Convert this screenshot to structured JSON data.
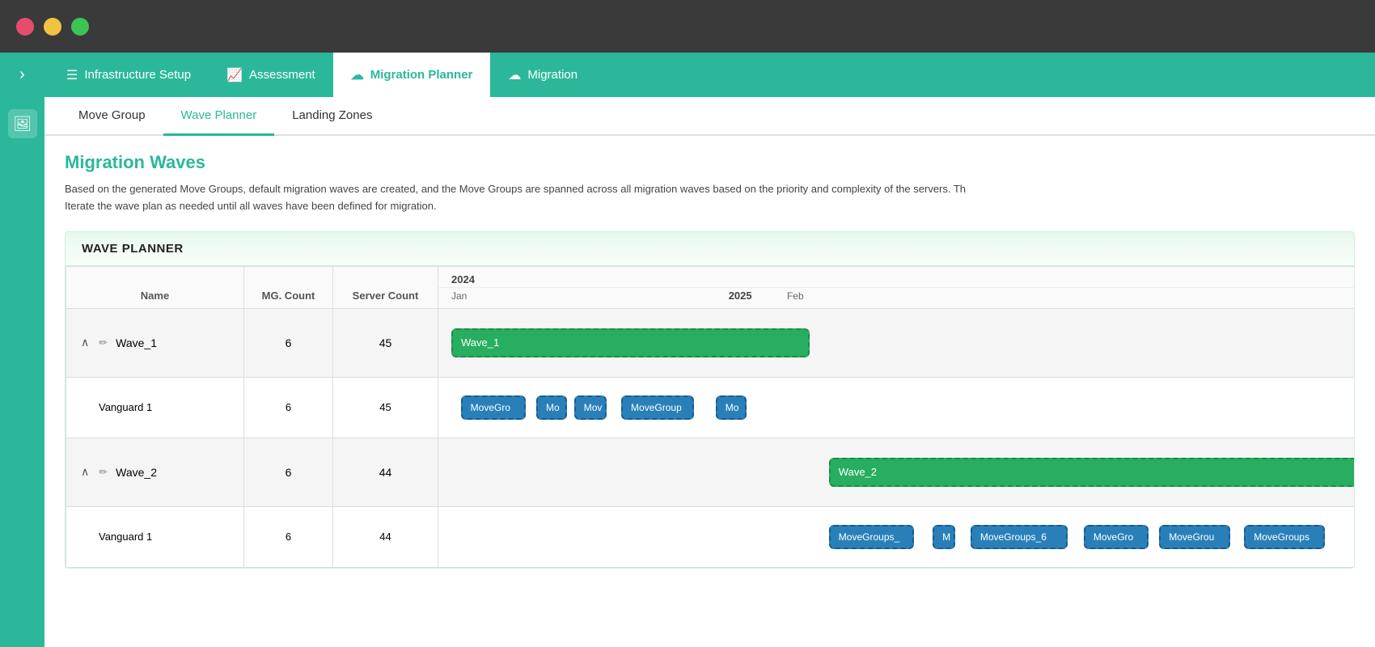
{
  "titleBar": {
    "trafficLights": [
      "red",
      "yellow",
      "green"
    ]
  },
  "topNav": {
    "toggleIcon": "☰",
    "items": [
      {
        "id": "infrastructure",
        "label": "Infrastructure Setup",
        "icon": "≡",
        "active": false
      },
      {
        "id": "assessment",
        "label": "Assessment",
        "icon": "📊",
        "active": false
      },
      {
        "id": "migration-planner",
        "label": "Migration Planner",
        "icon": "☁",
        "active": true
      },
      {
        "id": "migration",
        "label": "Migration",
        "icon": "☁",
        "active": false
      }
    ]
  },
  "sidebar": {
    "icons": [
      "🖼"
    ]
  },
  "tabs": [
    {
      "id": "move-group",
      "label": "Move Group",
      "active": false
    },
    {
      "id": "wave-planner",
      "label": "Wave Planner",
      "active": true
    },
    {
      "id": "landing-zones",
      "label": "Landing Zones",
      "active": false
    }
  ],
  "content": {
    "title": "Migration Waves",
    "description1": "Based on the generated Move Groups, default migration waves are created, and the Move Groups are spanned across all migration waves based on the priority and complexity of the servers. Th",
    "description2": "Iterate the wave plan as needed until all waves have been defined for migration.",
    "wavePlanner": {
      "header": "WAVE PLANNER",
      "tableHeaders": {
        "name": "Name",
        "mgCount": "MG. Count",
        "serverCount": "Server Count"
      },
      "timelineYears": [
        {
          "label": "2024",
          "colSpan": 1
        },
        {
          "label": "2025",
          "colSpan": 1
        }
      ],
      "timelineMonths": [
        "Jan",
        "Feb"
      ],
      "rows": [
        {
          "type": "wave",
          "name": "Wave_1",
          "mgCount": "6",
          "serverCount": "45",
          "gantt": [
            {
              "type": "green",
              "label": "Wave_1",
              "leftPct": 0,
              "widthPct": 38
            }
          ],
          "subrows": [
            {
              "name": "Vanguard 1",
              "mgCount": "6",
              "serverCount": "45",
              "gantt": [
                {
                  "type": "blue",
                  "label": "MoveGro",
                  "leftPct": 1,
                  "widthPx": 80
                },
                {
                  "type": "blue",
                  "label": "Mo",
                  "leftPct": 9,
                  "widthPx": 38
                },
                {
                  "type": "blue",
                  "label": "Mov",
                  "leftPct": 13,
                  "widthPx": 40
                },
                {
                  "type": "blue",
                  "label": "MoveGroup",
                  "leftPct": 18,
                  "widthPx": 90
                },
                {
                  "type": "blue",
                  "label": "Mo",
                  "leftPct": 28,
                  "widthPx": 38
                }
              ]
            }
          ]
        },
        {
          "type": "wave",
          "name": "Wave_2",
          "mgCount": "6",
          "serverCount": "44",
          "gantt": [
            {
              "type": "green",
              "label": "Wave_2",
              "leftPct": 40,
              "widthPct": 58
            }
          ],
          "subrows": [
            {
              "name": "Vanguard 1",
              "mgCount": "6",
              "serverCount": "44",
              "gantt": [
                {
                  "type": "blue",
                  "label": "MoveGroups_",
                  "leftPct": 40,
                  "widthPx": 105
                },
                {
                  "type": "blue",
                  "label": "M",
                  "leftPct": 51,
                  "widthPx": 28
                },
                {
                  "type": "blue",
                  "label": "MoveGroups_6",
                  "leftPct": 55,
                  "widthPx": 120
                },
                {
                  "type": "blue",
                  "label": "MoveGro",
                  "leftPct": 67,
                  "widthPx": 80
                },
                {
                  "type": "blue",
                  "label": "MoveGrou",
                  "leftPct": 75,
                  "widthPx": 88
                },
                {
                  "type": "blue",
                  "label": "MoveGroups",
                  "leftPct": 84,
                  "widthPx": 100
                }
              ]
            }
          ]
        }
      ]
    }
  }
}
